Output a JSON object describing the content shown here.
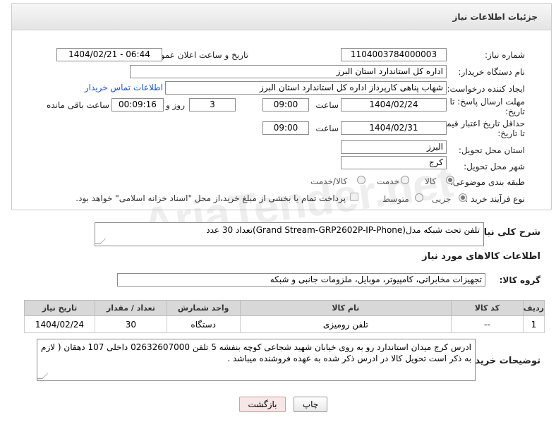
{
  "panel": {
    "title": "جزئیات اطلاعات نیاز"
  },
  "fields": {
    "need_number_label": "شماره نیاز:",
    "need_number": "1104003784000003",
    "announce_label": "تاریخ و ساعت اعلان عمومی:",
    "announce_value": "1404/02/21 - 06:44",
    "buyer_label": "نام دستگاه خریدار:",
    "buyer_value": "اداره کل استاندارد استان البرز",
    "creator_label": "ایجاد کننده درخواست:",
    "creator_value": "شهاب پناهی کارپرداز اداره کل استاندارد استان البرز",
    "contact_link": "اطلاعات تماس خریدار",
    "deadline_label_1": "مهلت ارسال پاسخ: تا",
    "deadline_label_2": "تاریخ:",
    "deadline_date": "1404/02/24",
    "time_label": "ساعت",
    "deadline_time": "09:00",
    "days_value": "3",
    "days_label": "روز و",
    "remaining_value": "00:09:16",
    "remaining_label": "ساعت باقی مانده",
    "validity_label_1": "حداقل تاریخ اعتبار قیمت:",
    "validity_label_2": "تا تاریخ:",
    "validity_date": "1404/02/31",
    "validity_time": "09:00",
    "province_label": "استان محل تحویل:",
    "province_value": "البرز",
    "city_label": "شهر محل تحویل:",
    "city_value": "کرج",
    "category_label": "طبقه بندی موضوعی:",
    "category_options": [
      "کالا",
      "خدمت",
      "کالا/خدمت"
    ],
    "category_selected": "کالا",
    "process_label": "نوع فرآیند خرید :",
    "process_options": [
      "جزیی",
      "متوسط"
    ],
    "process_selected": "جزیی",
    "payment_note": "پرداخت تمام یا بخشی از مبلغ خرید،از محل \"اسناد خزانه اسلامی\" خواهد بود."
  },
  "description": {
    "label": "شرح کلی نیاز:",
    "value": "تلفن تحت شبکه مدل(Grand Stream-GRP2602P-IP-Phone)تعداد 30 عدد"
  },
  "goods_info": {
    "heading": "اطلاعات کالاهای مورد نیاز",
    "group_label": "گروه کالا:",
    "group_value": "تجهیزات مخابراتی، کامپیوتر، موبایل، ملزومات جانبی و شبکه"
  },
  "table": {
    "headers": [
      "ردیف",
      "کد کالا",
      "نام کالا",
      "واحد شمارش",
      "تعداد / مقدار",
      "تاریخ نیاز"
    ],
    "rows": [
      [
        "1",
        "--",
        "تلفن رومیزی",
        "دستگاه",
        "30",
        "1404/02/24"
      ]
    ]
  },
  "buyer_notes": {
    "label": "توضیحات خریدار:",
    "value": "ادرس کرج میدان استاندارد رو به روی خیابان شهید شجاعی کوچه بنفشه 5 تلفن 02632607000 داخلی 107 دهقان ( لازم به ذکر است تحویل کالا در ادرس ذکر شده به عهده فروشنده میباشد ."
  },
  "buttons": {
    "print": "چاپ",
    "back": "بازگشت"
  },
  "watermark": "AriaTender.net"
}
